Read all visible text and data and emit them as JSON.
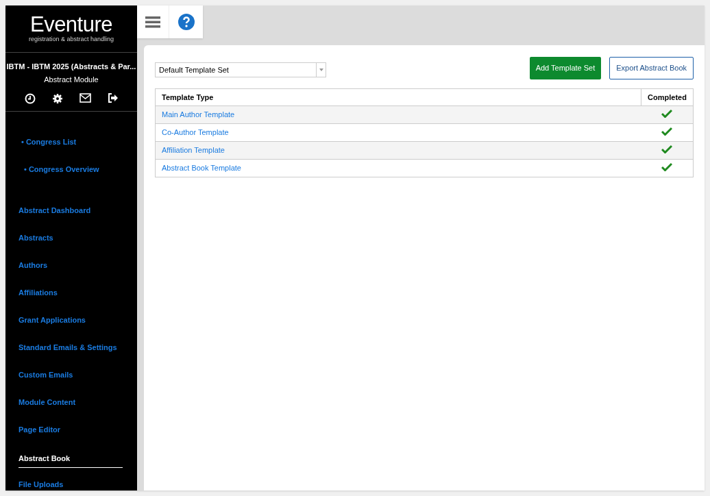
{
  "logo": {
    "title": "Eventure",
    "subtitle": "registration & abstract handling"
  },
  "congress": {
    "title": "IBTM - IBTM 2025 (Abstracts & Par...",
    "module": "Abstract Module"
  },
  "top_links": [
    "• Congress List",
    "• Congress Overview"
  ],
  "nav": [
    {
      "label": "Abstract Dashboard",
      "selected": false
    },
    {
      "label": "Abstracts",
      "selected": false
    },
    {
      "label": "Authors",
      "selected": false
    },
    {
      "label": "Affiliations",
      "selected": false
    },
    {
      "label": "Grant Applications",
      "selected": false
    },
    {
      "label": "Standard Emails & Settings",
      "selected": false
    },
    {
      "label": "Custom Emails",
      "selected": false
    },
    {
      "label": "Module Content",
      "selected": false
    },
    {
      "label": "Page Editor",
      "selected": false
    },
    {
      "label": "Abstract Book",
      "selected": true
    },
    {
      "label": "File Uploads",
      "selected": false
    }
  ],
  "template_set": {
    "value": "Default Template Set"
  },
  "buttons": [
    {
      "label": "Add Template Set",
      "kind": "primary"
    },
    {
      "label": "Export Abstract Book",
      "kind": "outline"
    }
  ],
  "table": {
    "columns": [
      "Template Type",
      "Completed"
    ],
    "rows": [
      {
        "name": "Main Author Template",
        "completed": true
      },
      {
        "name": "Co-Author Template",
        "completed": true
      },
      {
        "name": "Affiliation Template",
        "completed": true
      },
      {
        "name": "Abstract Book Template",
        "completed": true
      }
    ]
  }
}
